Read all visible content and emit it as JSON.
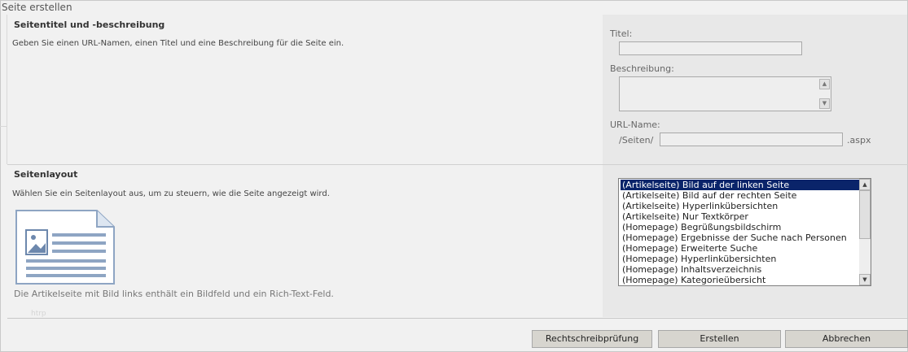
{
  "page": {
    "title": "Seite erstellen"
  },
  "section_title": {
    "heading": "Seitentitel und -beschreibung",
    "description": "Geben Sie einen URL-Namen, einen Titel und eine Beschreibung für die Seite ein.",
    "title_label": "Titel:",
    "title_value": "",
    "description_label": "Beschreibung:",
    "description_value": "",
    "url_label": "URL-Name:",
    "url_prefix": "/Seiten/",
    "url_value": "",
    "url_suffix": ".aspx"
  },
  "section_layout": {
    "heading": "Seitenlayout",
    "description": "Wählen Sie ein Seitenlayout aus, um zu steuern, wie die Seite angezeigt wird.",
    "preview_caption": "Die Artikelseite mit Bild links enthält ein Bildfeld und ein Rich-Text-Feld.",
    "preview_note": "htrp",
    "selected_index": 0,
    "options": [
      "(Artikelseite) Bild auf der linken Seite",
      "(Artikelseite) Bild auf der rechten Seite",
      "(Artikelseite) Hyperlinkübersichten",
      "(Artikelseite) Nur Textkörper",
      "(Homepage) Begrüßungsbildschirm",
      "(Homepage) Ergebnisse der Suche nach Personen",
      "(Homepage) Erweiterte Suche",
      "(Homepage) Hyperlinkübersichten",
      "(Homepage) Inhaltsverzeichnis",
      "(Homepage) Kategorieübersicht"
    ]
  },
  "buttons": {
    "spellcheck": "Rechtschreibprüfung",
    "create": "Erstellen",
    "cancel": "Abbrechen"
  },
  "icons": {
    "spin_up": "arrow-up-icon",
    "spin_down": "arrow-down-icon",
    "preview": "page-layout-preview-icon"
  }
}
